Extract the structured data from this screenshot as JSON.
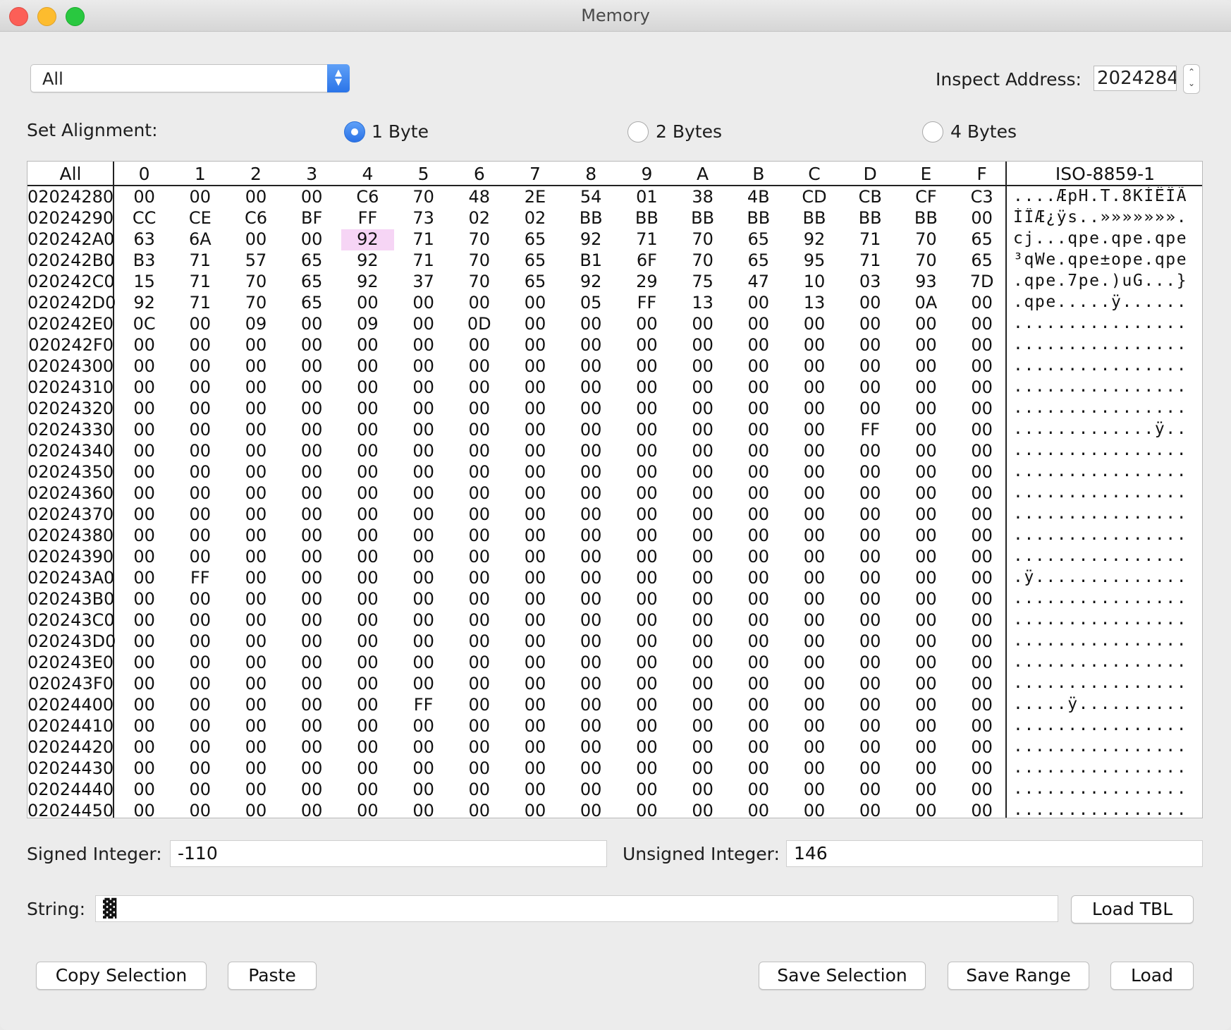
{
  "window": {
    "title": "Memory"
  },
  "filter": {
    "selected": "All"
  },
  "inspect": {
    "label": "Inspect Address:",
    "value": "2024284"
  },
  "alignment": {
    "label": "Set Alignment:",
    "options": [
      "1 Byte",
      "2 Bytes",
      "4 Bytes"
    ],
    "selected": "1 Byte"
  },
  "table": {
    "corner_header": "All",
    "col_headers": [
      "0",
      "1",
      "2",
      "3",
      "4",
      "5",
      "6",
      "7",
      "8",
      "9",
      "A",
      "B",
      "C",
      "D",
      "E",
      "F"
    ],
    "ascii_header": "ISO-8859-1",
    "selected_cell": {
      "address": "020242A0",
      "column": "4"
    },
    "rows": [
      {
        "addr": "02024280",
        "bytes": [
          "00",
          "00",
          "00",
          "00",
          "C6",
          "70",
          "48",
          "2E",
          "54",
          "01",
          "38",
          "4B",
          "CD",
          "CB",
          "CF",
          "C3"
        ],
        "ascii": "....ÆpH.T.8KÍËÏÃ"
      },
      {
        "addr": "02024290",
        "bytes": [
          "CC",
          "CE",
          "C6",
          "BF",
          "FF",
          "73",
          "02",
          "02",
          "BB",
          "BB",
          "BB",
          "BB",
          "BB",
          "BB",
          "BB",
          "00"
        ],
        "ascii": "ÌÎÆ¿ÿs..»»»»»»»."
      },
      {
        "addr": "020242A0",
        "bytes": [
          "63",
          "6A",
          "00",
          "00",
          "92",
          "71",
          "70",
          "65",
          "92",
          "71",
          "70",
          "65",
          "92",
          "71",
          "70",
          "65"
        ],
        "ascii": "cj...qpe.qpe.qpe"
      },
      {
        "addr": "020242B0",
        "bytes": [
          "B3",
          "71",
          "57",
          "65",
          "92",
          "71",
          "70",
          "65",
          "B1",
          "6F",
          "70",
          "65",
          "95",
          "71",
          "70",
          "65"
        ],
        "ascii": "³qWe.qpe±ope.qpe"
      },
      {
        "addr": "020242C0",
        "bytes": [
          "15",
          "71",
          "70",
          "65",
          "92",
          "37",
          "70",
          "65",
          "92",
          "29",
          "75",
          "47",
          "10",
          "03",
          "93",
          "7D"
        ],
        "ascii": ".qpe.7pe.)uG...}"
      },
      {
        "addr": "020242D0",
        "bytes": [
          "92",
          "71",
          "70",
          "65",
          "00",
          "00",
          "00",
          "00",
          "05",
          "FF",
          "13",
          "00",
          "13",
          "00",
          "0A",
          "00"
        ],
        "ascii": ".qpe.....ÿ......"
      },
      {
        "addr": "020242E0",
        "bytes": [
          "0C",
          "00",
          "09",
          "00",
          "09",
          "00",
          "0D",
          "00",
          "00",
          "00",
          "00",
          "00",
          "00",
          "00",
          "00",
          "00"
        ],
        "ascii": "................"
      },
      {
        "addr": "020242F0",
        "bytes": [
          "00",
          "00",
          "00",
          "00",
          "00",
          "00",
          "00",
          "00",
          "00",
          "00",
          "00",
          "00",
          "00",
          "00",
          "00",
          "00"
        ],
        "ascii": "................"
      },
      {
        "addr": "02024300",
        "bytes": [
          "00",
          "00",
          "00",
          "00",
          "00",
          "00",
          "00",
          "00",
          "00",
          "00",
          "00",
          "00",
          "00",
          "00",
          "00",
          "00"
        ],
        "ascii": "................"
      },
      {
        "addr": "02024310",
        "bytes": [
          "00",
          "00",
          "00",
          "00",
          "00",
          "00",
          "00",
          "00",
          "00",
          "00",
          "00",
          "00",
          "00",
          "00",
          "00",
          "00"
        ],
        "ascii": "................"
      },
      {
        "addr": "02024320",
        "bytes": [
          "00",
          "00",
          "00",
          "00",
          "00",
          "00",
          "00",
          "00",
          "00",
          "00",
          "00",
          "00",
          "00",
          "00",
          "00",
          "00"
        ],
        "ascii": "................"
      },
      {
        "addr": "02024330",
        "bytes": [
          "00",
          "00",
          "00",
          "00",
          "00",
          "00",
          "00",
          "00",
          "00",
          "00",
          "00",
          "00",
          "00",
          "FF",
          "00",
          "00"
        ],
        "ascii": ".............ÿ.."
      },
      {
        "addr": "02024340",
        "bytes": [
          "00",
          "00",
          "00",
          "00",
          "00",
          "00",
          "00",
          "00",
          "00",
          "00",
          "00",
          "00",
          "00",
          "00",
          "00",
          "00"
        ],
        "ascii": "................"
      },
      {
        "addr": "02024350",
        "bytes": [
          "00",
          "00",
          "00",
          "00",
          "00",
          "00",
          "00",
          "00",
          "00",
          "00",
          "00",
          "00",
          "00",
          "00",
          "00",
          "00"
        ],
        "ascii": "................"
      },
      {
        "addr": "02024360",
        "bytes": [
          "00",
          "00",
          "00",
          "00",
          "00",
          "00",
          "00",
          "00",
          "00",
          "00",
          "00",
          "00",
          "00",
          "00",
          "00",
          "00"
        ],
        "ascii": "................"
      },
      {
        "addr": "02024370",
        "bytes": [
          "00",
          "00",
          "00",
          "00",
          "00",
          "00",
          "00",
          "00",
          "00",
          "00",
          "00",
          "00",
          "00",
          "00",
          "00",
          "00"
        ],
        "ascii": "................"
      },
      {
        "addr": "02024380",
        "bytes": [
          "00",
          "00",
          "00",
          "00",
          "00",
          "00",
          "00",
          "00",
          "00",
          "00",
          "00",
          "00",
          "00",
          "00",
          "00",
          "00"
        ],
        "ascii": "................"
      },
      {
        "addr": "02024390",
        "bytes": [
          "00",
          "00",
          "00",
          "00",
          "00",
          "00",
          "00",
          "00",
          "00",
          "00",
          "00",
          "00",
          "00",
          "00",
          "00",
          "00"
        ],
        "ascii": "................"
      },
      {
        "addr": "020243A0",
        "bytes": [
          "00",
          "FF",
          "00",
          "00",
          "00",
          "00",
          "00",
          "00",
          "00",
          "00",
          "00",
          "00",
          "00",
          "00",
          "00",
          "00"
        ],
        "ascii": ".ÿ.............."
      },
      {
        "addr": "020243B0",
        "bytes": [
          "00",
          "00",
          "00",
          "00",
          "00",
          "00",
          "00",
          "00",
          "00",
          "00",
          "00",
          "00",
          "00",
          "00",
          "00",
          "00"
        ],
        "ascii": "................"
      },
      {
        "addr": "020243C0",
        "bytes": [
          "00",
          "00",
          "00",
          "00",
          "00",
          "00",
          "00",
          "00",
          "00",
          "00",
          "00",
          "00",
          "00",
          "00",
          "00",
          "00"
        ],
        "ascii": "................"
      },
      {
        "addr": "020243D0",
        "bytes": [
          "00",
          "00",
          "00",
          "00",
          "00",
          "00",
          "00",
          "00",
          "00",
          "00",
          "00",
          "00",
          "00",
          "00",
          "00",
          "00"
        ],
        "ascii": "................"
      },
      {
        "addr": "020243E0",
        "bytes": [
          "00",
          "00",
          "00",
          "00",
          "00",
          "00",
          "00",
          "00",
          "00",
          "00",
          "00",
          "00",
          "00",
          "00",
          "00",
          "00"
        ],
        "ascii": "................"
      },
      {
        "addr": "020243F0",
        "bytes": [
          "00",
          "00",
          "00",
          "00",
          "00",
          "00",
          "00",
          "00",
          "00",
          "00",
          "00",
          "00",
          "00",
          "00",
          "00",
          "00"
        ],
        "ascii": "................"
      },
      {
        "addr": "02024400",
        "bytes": [
          "00",
          "00",
          "00",
          "00",
          "00",
          "FF",
          "00",
          "00",
          "00",
          "00",
          "00",
          "00",
          "00",
          "00",
          "00",
          "00"
        ],
        "ascii": ".....ÿ.........."
      },
      {
        "addr": "02024410",
        "bytes": [
          "00",
          "00",
          "00",
          "00",
          "00",
          "00",
          "00",
          "00",
          "00",
          "00",
          "00",
          "00",
          "00",
          "00",
          "00",
          "00"
        ],
        "ascii": "................"
      },
      {
        "addr": "02024420",
        "bytes": [
          "00",
          "00",
          "00",
          "00",
          "00",
          "00",
          "00",
          "00",
          "00",
          "00",
          "00",
          "00",
          "00",
          "00",
          "00",
          "00"
        ],
        "ascii": "................"
      },
      {
        "addr": "02024430",
        "bytes": [
          "00",
          "00",
          "00",
          "00",
          "00",
          "00",
          "00",
          "00",
          "00",
          "00",
          "00",
          "00",
          "00",
          "00",
          "00",
          "00"
        ],
        "ascii": "................"
      },
      {
        "addr": "02024440",
        "bytes": [
          "00",
          "00",
          "00",
          "00",
          "00",
          "00",
          "00",
          "00",
          "00",
          "00",
          "00",
          "00",
          "00",
          "00",
          "00",
          "00"
        ],
        "ascii": "................"
      },
      {
        "addr": "02024450",
        "bytes": [
          "00",
          "00",
          "00",
          "00",
          "00",
          "00",
          "00",
          "00",
          "00",
          "00",
          "00",
          "00",
          "00",
          "00",
          "00",
          "00"
        ],
        "ascii": "................"
      }
    ]
  },
  "values": {
    "signed_label": "Signed Integer:",
    "signed_value": "-110",
    "unsigned_label": "Unsigned Integer:",
    "unsigned_value": "146",
    "string_label": "String:",
    "string_value": "▓"
  },
  "buttons": {
    "load_tbl": "Load TBL",
    "copy_selection": "Copy Selection",
    "paste": "Paste",
    "save_selection": "Save Selection",
    "save_range": "Save Range",
    "load": "Load"
  },
  "colors": {
    "accent": "#2b72e6",
    "selection_highlight": "#f6d5f5"
  }
}
